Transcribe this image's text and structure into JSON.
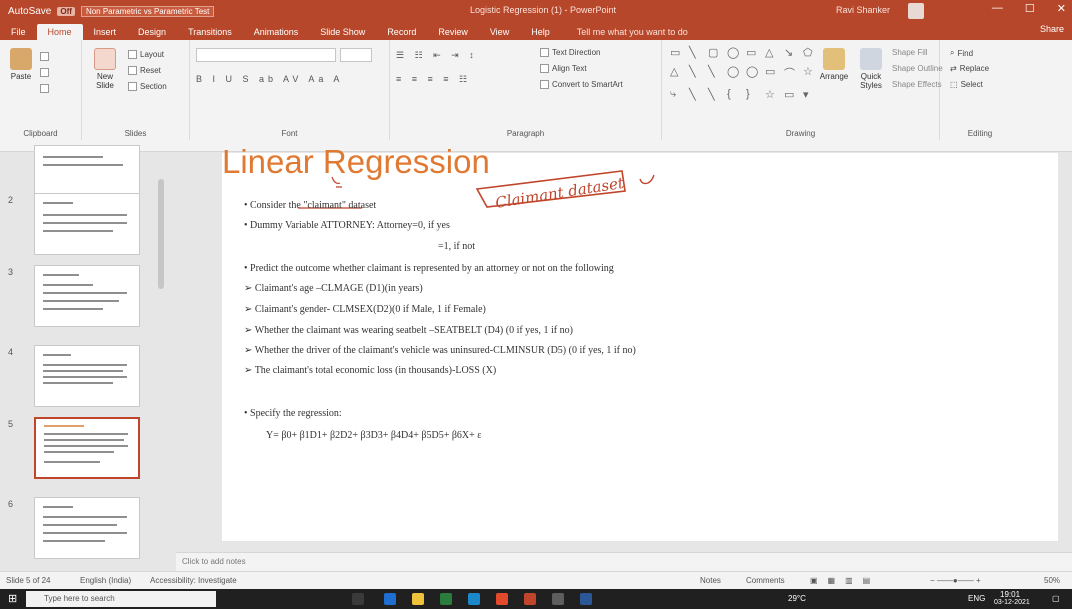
{
  "titlebar": {
    "autosave": "AutoSave",
    "autosave_state": "Off",
    "doc_tab": "Non Parametric vs Parametric Test",
    "window_title": "Logistic Regression (1) - PowerPoint",
    "account": "Ravi Shanker",
    "controls": [
      "—",
      "☐",
      "✕"
    ]
  },
  "tabs": [
    "File",
    "Home",
    "Insert",
    "Design",
    "Transitions",
    "Animations",
    "Slide Show",
    "Record",
    "Review",
    "View",
    "Help"
  ],
  "tell_me": "Tell me what you want to do",
  "share_label": "Share",
  "ribbon": {
    "clipboard": {
      "paste": "Paste",
      "label": "Clipboard"
    },
    "slides": {
      "new_slide": "New Slide",
      "layout": "Layout",
      "reset": "Reset",
      "section": "Section",
      "label": "Slides"
    },
    "font": {
      "label": "Font"
    },
    "paragraph": {
      "text_direction": "Text Direction",
      "align_text": "Align Text",
      "smartart": "Convert to SmartArt",
      "label": "Paragraph"
    },
    "drawing": {
      "arrange": "Arrange",
      "quick_styles": "Quick Styles",
      "shape_fill": "Shape Fill",
      "shape_outline": "Shape Outline",
      "shape_effects": "Shape Effects",
      "label": "Drawing"
    },
    "editing": {
      "find": "Find",
      "replace": "Replace",
      "select": "Select",
      "label": "Editing"
    }
  },
  "thumbnails": [
    {
      "num": "",
      "selected": false
    },
    {
      "num": "2",
      "selected": false
    },
    {
      "num": "3",
      "selected": false
    },
    {
      "num": "4",
      "selected": false
    },
    {
      "num": "5",
      "selected": true
    },
    {
      "num": "6",
      "selected": false
    }
  ],
  "slide": {
    "title": "Linear Regression",
    "annotation": "Claimant dataset",
    "bullets": [
      "•  Consider the \"claimant\" dataset",
      "•  Dummy Variable ATTORNEY:  Attorney=0, if yes",
      "=1, if not",
      "•  Predict the outcome whether claimant is represented by an attorney or not on the following",
      "➢ Claimant's age –CLMAGE (D1)(in years)",
      "➢ Claimant's gender- CLMSEX(D2)(0 if Male, 1 if Female)",
      "➢ Whether the claimant was wearing seatbelt –SEATBELT (D4) (0 if yes, 1 if no)",
      "➢ Whether the driver of the claimant's vehicle was uninsured-CLMINSUR (D5) (0 if yes, 1 if no)",
      "➢ The claimant's total economic loss (in thousands)-LOSS     (X)",
      "•  Specify the regression:",
      "Y= β0+ β1D1+ β2D2+ β3D3+ β4D4+ β5D5+ β6X+ ε"
    ]
  },
  "notes_placeholder": "Click to add notes",
  "status": {
    "slide_of": "Slide 5 of 24",
    "language": "English (India)",
    "accessibility": "Accessibility: Investigate",
    "notes": "Notes",
    "comments": "Comments",
    "zoom": "50%"
  },
  "taskbar": {
    "search_placeholder": "Type here to search",
    "weather": "29°C",
    "lang": "ENG",
    "time": "19:01",
    "date": "03-12-2021"
  },
  "colors": {
    "accent": "#b7472a",
    "title": "#e07a33",
    "ink": "#c0452b"
  }
}
